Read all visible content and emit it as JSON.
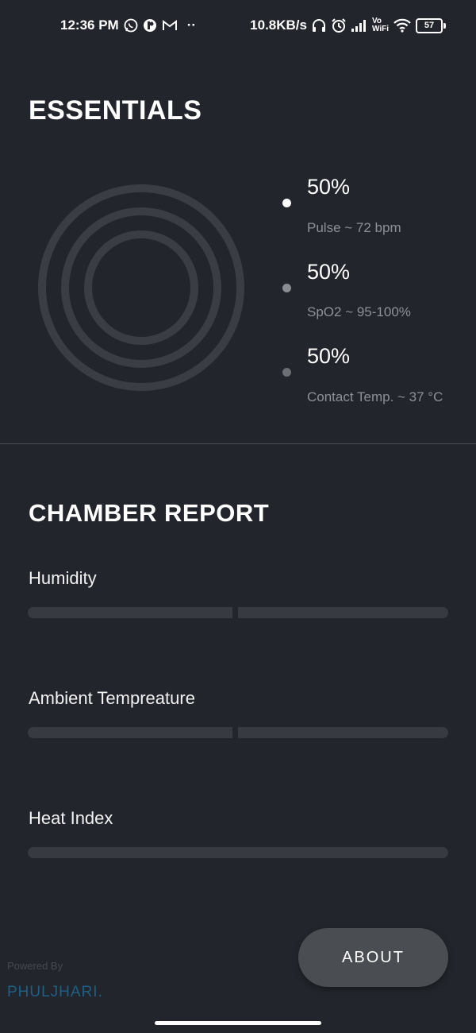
{
  "status_bar": {
    "time": "12:36 PM",
    "more": "··",
    "net_speed": "10.8KB/s",
    "vo": "Vo",
    "wifi_text": "WiFi",
    "battery": "57",
    "icons": [
      "whatsapp-icon",
      "app-icon",
      "gmail-icon",
      "headphones-icon",
      "alarm-icon",
      "signal-icon",
      "wifi-icon",
      "battery-icon"
    ]
  },
  "essentials": {
    "title": "ESSENTIALS",
    "metrics": [
      {
        "value": "50%",
        "label": "Pulse ~ 72 bpm",
        "dot_color": "#ffffff"
      },
      {
        "value": "50%",
        "label": "SpO2 ~ 95-100%",
        "dot_color": "#8a8d92"
      },
      {
        "value": "50%",
        "label": "Contact Temp. ~ 37 °C",
        "dot_color": "#6b6e73"
      }
    ]
  },
  "chamber": {
    "title": "CHAMBER REPORT",
    "items": [
      {
        "label": "Humidity"
      },
      {
        "label": "Ambient Tempreature"
      },
      {
        "label": "Heat Index"
      }
    ]
  },
  "footer": {
    "powered_by": "Powered By",
    "brand": "PHULJHARI",
    "brand_dot": ".",
    "about_label": "ABOUT"
  },
  "colors": {
    "background": "#22262c",
    "track": "#373a41",
    "ring": "#3a3d44",
    "brand": "#1f5e85",
    "button": "#4a4d52"
  }
}
